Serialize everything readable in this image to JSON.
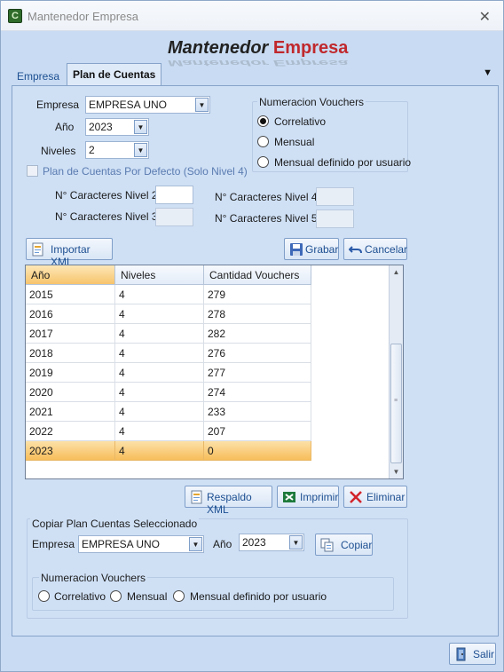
{
  "window": {
    "title": "Mantenedor Empresa",
    "close_glyph": "✕",
    "app_icon_letter": "C"
  },
  "banner": {
    "word1": "Mantenedor",
    "word2": "Empresa",
    "accent": "#c0282d"
  },
  "tabs": [
    {
      "label": "Empresa",
      "active": false
    },
    {
      "label": "Plan de Cuentas",
      "active": true
    }
  ],
  "form": {
    "empresa_label": "Empresa",
    "empresa_value": "EMPRESA UNO",
    "anio_label": "Año",
    "anio_value": "2023",
    "niveles_label": "Niveles",
    "niveles_value": "2",
    "defecto_label": "Plan de Cuentas Por Defecto (Solo Nivel 4)",
    "nivel2_label": "N° Caracteres Nivel 2",
    "nivel3_label": "N° Caracteres Nivel 3",
    "nivel4_label": "N° Caracteres Nivel 4",
    "nivel5_label": "N° Caracteres Nivel 5"
  },
  "numeracion": {
    "title": "Numeracion Vouchers",
    "options": [
      "Correlativo",
      "Mensual",
      "Mensual definido por usuario"
    ],
    "selected": 0
  },
  "buttons": {
    "importar": "Importar XML",
    "grabar": "Grabar",
    "cancelar": "Cancelar",
    "respaldo": "Respaldo XML",
    "imprimir": "Imprimir",
    "eliminar": "Eliminar",
    "copiar": "Copiar",
    "salir": "Salir"
  },
  "grid": {
    "columns": [
      "Año",
      "Niveles",
      "Cantidad Vouchers"
    ],
    "rows": [
      [
        "2015",
        "4",
        "279"
      ],
      [
        "2016",
        "4",
        "278"
      ],
      [
        "2017",
        "4",
        "282"
      ],
      [
        "2018",
        "4",
        "276"
      ],
      [
        "2019",
        "4",
        "277"
      ],
      [
        "2020",
        "4",
        "274"
      ],
      [
        "2021",
        "4",
        "233"
      ],
      [
        "2022",
        "4",
        "207"
      ],
      [
        "2023",
        "4",
        "0"
      ]
    ],
    "selected_row": 8
  },
  "copy": {
    "title": "Copiar Plan Cuentas Seleccionado",
    "empresa_label": "Empresa",
    "empresa_value": "EMPRESA UNO",
    "anio_label": "Año",
    "anio_value": "2023",
    "numeracion_title": "Numeracion Vouchers",
    "options": [
      "Correlativo",
      "Mensual",
      "Mensual definido por usuario"
    ]
  },
  "icons": {
    "importar": "import-xml-icon",
    "grabar": "save-disk-icon",
    "cancelar": "undo-icon",
    "respaldo": "backup-xml-icon",
    "imprimir": "excel-icon",
    "eliminar": "delete-x-icon",
    "copiar": "copy-icon",
    "salir": "exit-door-icon"
  }
}
